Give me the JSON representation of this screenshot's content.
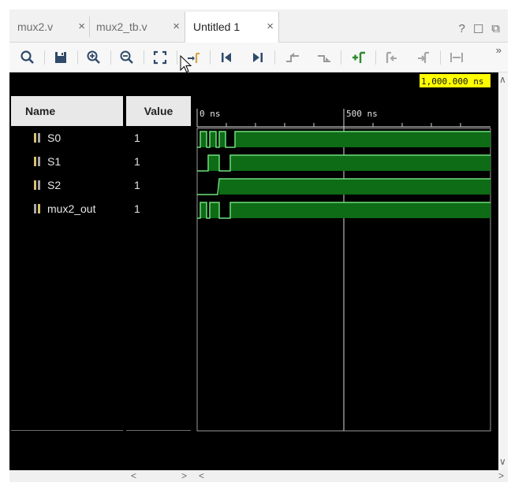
{
  "tabs": [
    {
      "label": "mux2.v",
      "active": false
    },
    {
      "label": "mux2_tb.v",
      "active": false
    },
    {
      "label": "Untitled 1",
      "active": true
    }
  ],
  "tab_close_glyph": "×",
  "window_buttons": {
    "help": "?",
    "restore": "☐",
    "float": "⧉"
  },
  "toolbar": {
    "icons": [
      "search-icon",
      "save-icon",
      "zoom-in-icon",
      "zoom-out-icon",
      "zoom-fit-icon",
      "go-to-cursor-icon",
      "go-to-time-zero-icon",
      "go-to-last-time-icon",
      "previous-transition-icon",
      "next-transition-icon",
      "add-marker-icon",
      "previous-marker-icon",
      "next-marker-icon",
      "swap-cursors-icon"
    ],
    "more": "»"
  },
  "accent_color": "#2d8a2d",
  "wave_color": "#0e6b16",
  "wave_edge_color": "#6fe07a",
  "cursor_label_bg": "#ffff00",
  "columns": {
    "name": "Name",
    "value": "Value"
  },
  "cursor_time": "1,000.000 ns",
  "time_ruler": {
    "labels": [
      "0 ns",
      "500 ns"
    ]
  },
  "signals": [
    {
      "name": "S0",
      "value": "1"
    },
    {
      "name": "S1",
      "value": "1"
    },
    {
      "name": "S2",
      "value": "1"
    },
    {
      "name": "mux2_out",
      "value": "1"
    }
  ],
  "scroll": {
    "left": "<",
    "right": ">",
    "down": "∨",
    "up": "∧"
  }
}
